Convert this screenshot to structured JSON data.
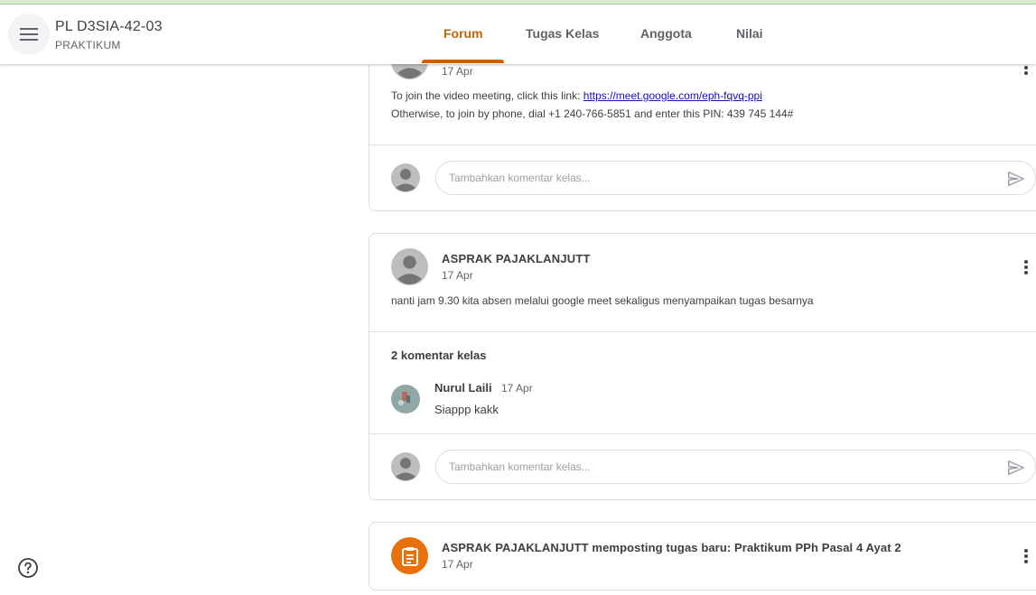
{
  "header": {
    "class_title": "PL D3SIA-42-03",
    "class_subtitle": "PRAKTIKUM",
    "tabs": [
      {
        "label": "Forum",
        "active": true
      },
      {
        "label": "Tugas Kelas",
        "active": false
      },
      {
        "label": "Anggota",
        "active": false
      },
      {
        "label": "Nilai",
        "active": false
      }
    ]
  },
  "posts": [
    {
      "date": "17 Apr",
      "line1_prefix": "To join the video meeting, click this link: ",
      "line1_link": "https://meet.google.com/eph-fqvq-ppi",
      "line2": "Otherwise, to join by phone, dial +1 240-766-5851 and enter this PIN: 439 745 144#",
      "comment_placeholder": "Tambahkan komentar kelas..."
    },
    {
      "author": "ASPRAK PAJAKLANJUTT",
      "date": "17 Apr",
      "text": "nanti jam 9.30 kita absen melalui google meet sekaligus menyampaikan tugas besarnya",
      "comment_count": "2 komentar kelas",
      "comments": [
        {
          "author": "Nurul Laili",
          "date": "17 Apr",
          "text": "Siappp kakk"
        }
      ],
      "comment_placeholder": "Tambahkan komentar kelas..."
    },
    {
      "title": "ASPRAK PAJAKLANJUTT memposting tugas baru: Praktikum PPh Pasal 4 Ayat 2",
      "date": "17 Apr"
    }
  ],
  "colors": {
    "accent": "#c26401",
    "task_icon_bg": "#e8710a",
    "link": "#1a0dab"
  },
  "icons": {
    "menu": "hamburger-icon",
    "send": "send-icon",
    "help": "help-icon",
    "more": "more-vert-icon",
    "assignment": "assignment-icon"
  }
}
